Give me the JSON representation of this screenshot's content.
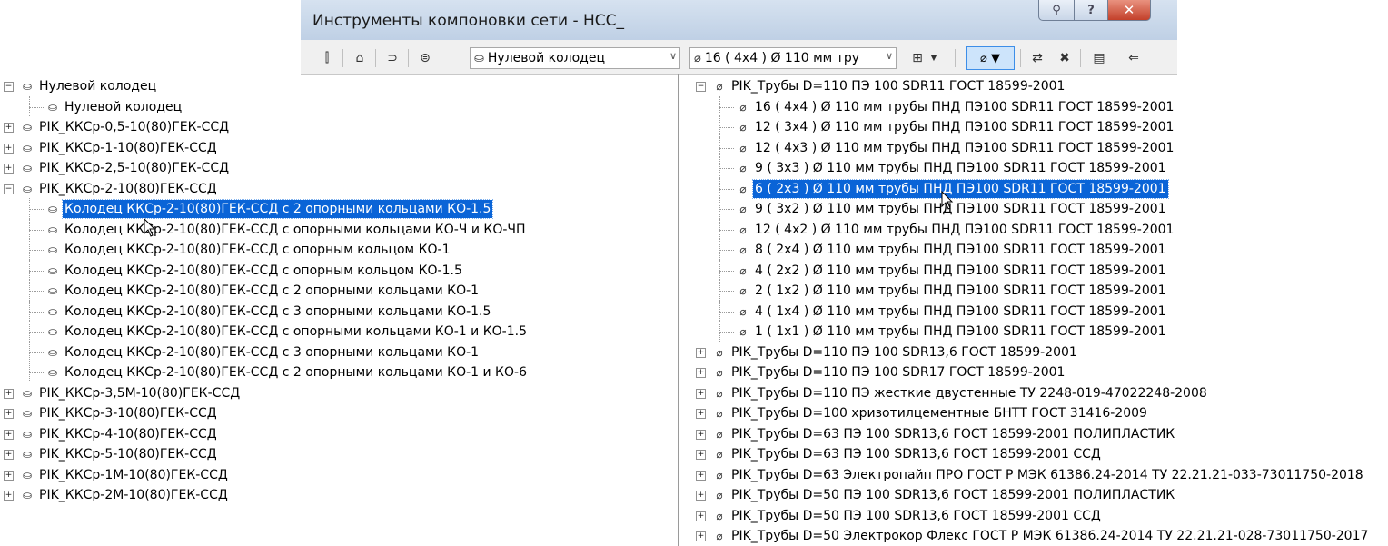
{
  "window": {
    "title": "Инструменты компоновки сети - НСС_",
    "pin_icon": "pin-icon",
    "help_label": "?",
    "close_label": "✕"
  },
  "toolbar": {
    "structure_combo": {
      "value": "Нулевой колодец",
      "icon": "manhole-icon"
    },
    "pipe_combo": {
      "value": "16 ( 4x4 ) Ø 110 мм тру",
      "icon": "pipe-icon"
    },
    "icons": [
      "network-properties-icon",
      "add-structure-icon",
      "draw-pipes-icon",
      "pipe-rules-icon",
      "insert-fitting-icon",
      "draw-pipes-and-structures-icon",
      "swap-part-icon",
      "delete-part-icon",
      "panorama-icon",
      "undo-icon"
    ]
  },
  "left_tree": {
    "items": [
      {
        "label": "Нулевой колодец",
        "level": 0,
        "expander": "−"
      },
      {
        "label": "Нулевой колодец",
        "level": 1
      },
      {
        "label": "PIK_ККСр-0,5-10(80)ГЕК-ССД",
        "level": 0,
        "expander": "+"
      },
      {
        "label": "PIK_ККСр-1-10(80)ГЕК-ССД",
        "level": 0,
        "expander": "+"
      },
      {
        "label": "PIK_ККСр-2,5-10(80)ГЕК-ССД",
        "level": 0,
        "expander": "+"
      },
      {
        "label": "PIK_ККСр-2-10(80)ГЕК-ССД",
        "level": 0,
        "expander": "−"
      },
      {
        "label": "Колодец ККСр-2-10(80)ГЕК-ССД с 2 опорными кольцами КО-1.5",
        "level": 1,
        "selected": true
      },
      {
        "label": "Колодец ККСр-2-10(80)ГЕК-ССД с опорными кольцами КО-Ч и КО-ЧП",
        "level": 1
      },
      {
        "label": "Колодец ККСр-2-10(80)ГЕК-ССД с опорным кольцом КО-1",
        "level": 1
      },
      {
        "label": "Колодец ККСр-2-10(80)ГЕК-ССД с опорным кольцом КО-1.5",
        "level": 1
      },
      {
        "label": "Колодец ККСр-2-10(80)ГЕК-ССД с 2 опорными кольцами КО-1",
        "level": 1
      },
      {
        "label": "Колодец ККСр-2-10(80)ГЕК-ССД с 3 опорными кольцами КО-1.5",
        "level": 1
      },
      {
        "label": "Колодец ККСр-2-10(80)ГЕК-ССД с опорными кольцами КО-1 и КО-1.5",
        "level": 1
      },
      {
        "label": "Колодец ККСр-2-10(80)ГЕК-ССД с 3 опорными кольцами КО-1",
        "level": 1
      },
      {
        "label": "Колодец ККСр-2-10(80)ГЕК-ССД с 2 опорными кольцами КО-1 и КО-6",
        "level": 1
      },
      {
        "label": "PIK_ККСр-3,5М-10(80)ГЕК-ССД",
        "level": 0,
        "expander": "+"
      },
      {
        "label": "PIK_ККСр-3-10(80)ГЕК-ССД",
        "level": 0,
        "expander": "+"
      },
      {
        "label": "PIK_ККСр-4-10(80)ГЕК-ССД",
        "level": 0,
        "expander": "+"
      },
      {
        "label": "PIK_ККСр-5-10(80)ГЕК-ССД",
        "level": 0,
        "expander": "+"
      },
      {
        "label": "PIK_ККСр-1М-10(80)ГЕК-ССД",
        "level": 0,
        "expander": "+"
      },
      {
        "label": "PIK_ККСр-2М-10(80)ГЕК-ССД",
        "level": 0,
        "expander": "+"
      }
    ]
  },
  "right_tree": {
    "items": [
      {
        "label": "PIK_Трубы D=110 ПЭ 100 SDR11 ГОСТ 18599-2001",
        "level": 0,
        "expander": "−"
      },
      {
        "label": "16 ( 4x4 ) Ø 110 мм трубы ПНД ПЭ100 SDR11 ГОСТ 18599-2001",
        "level": 1
      },
      {
        "label": "12 ( 3x4 ) Ø 110 мм трубы ПНД ПЭ100 SDR11 ГОСТ 18599-2001",
        "level": 1
      },
      {
        "label": "12 ( 4x3 ) Ø 110 мм трубы ПНД ПЭ100 SDR11 ГОСТ 18599-2001",
        "level": 1
      },
      {
        "label": "9 ( 3x3 ) Ø 110 мм трубы ПНД ПЭ100 SDR11 ГОСТ 18599-2001",
        "level": 1
      },
      {
        "label": "6 ( 2x3 ) Ø 110 мм трубы ПНД ПЭ100 SDR11 ГОСТ 18599-2001",
        "level": 1,
        "selected": true
      },
      {
        "label": "9 ( 3x2 ) Ø 110 мм трубы ПНД ПЭ100 SDR11 ГОСТ 18599-2001",
        "level": 1
      },
      {
        "label": "12 ( 4x2 ) Ø 110 мм трубы ПНД ПЭ100 SDR11 ГОСТ 18599-2001",
        "level": 1
      },
      {
        "label": "8 ( 2x4 ) Ø 110 мм трубы ПНД ПЭ100 SDR11 ГОСТ 18599-2001",
        "level": 1
      },
      {
        "label": "4 ( 2x2 ) Ø 110 мм трубы ПНД ПЭ100 SDR11 ГОСТ 18599-2001",
        "level": 1
      },
      {
        "label": "2 ( 1x2 ) Ø 110 мм трубы ПНД ПЭ100 SDR11 ГОСТ 18599-2001",
        "level": 1
      },
      {
        "label": "4 ( 1x4 ) Ø 110 мм трубы ПНД ПЭ100 SDR11 ГОСТ 18599-2001",
        "level": 1
      },
      {
        "label": "1 ( 1x1 ) Ø 110 мм трубы ПНД ПЭ100 SDR11 ГОСТ 18599-2001",
        "level": 1
      },
      {
        "label": "PIK_Трубы D=110 ПЭ 100 SDR13,6 ГОСТ 18599-2001",
        "level": 0,
        "expander": "+"
      },
      {
        "label": "PIK_Трубы D=110 ПЭ 100 SDR17 ГОСТ 18599-2001",
        "level": 0,
        "expander": "+"
      },
      {
        "label": "PIK_Трубы D=110 ПЭ жесткие двустенные ТУ 2248-019-47022248-2008",
        "level": 0,
        "expander": "+"
      },
      {
        "label": "PIK_Трубы D=100 хризотилцементные БНТТ ГОСТ 31416-2009",
        "level": 0,
        "expander": "+"
      },
      {
        "label": "PIK_Трубы D=63 ПЭ 100 SDR13,6 ГОСТ 18599-2001 ПОЛИПЛАСТИК",
        "level": 0,
        "expander": "+"
      },
      {
        "label": "PIK_Трубы D=63 ПЭ 100 SDR13,6 ГОСТ 18599-2001 ССД",
        "level": 0,
        "expander": "+"
      },
      {
        "label": "PIK_Трубы D=63 Электропайп ПРО ГОСТ Р МЭК 61386.24-2014 ТУ 22.21.21-033-73011750-2018",
        "level": 0,
        "expander": "+"
      },
      {
        "label": "PIK_Трубы D=50 ПЭ 100 SDR13,6 ГОСТ 18599-2001 ПОЛИПЛАСТИК",
        "level": 0,
        "expander": "+"
      },
      {
        "label": "PIK_Трубы D=50 ПЭ 100 SDR13,6 ГОСТ 18599-2001 ССД",
        "level": 0,
        "expander": "+"
      },
      {
        "label": "PIK_Трубы D=50 Электрокор Флекс ГОСТ Р МЭК 61386.24-2014 ТУ 22.21.21-028-73011750-2017",
        "level": 0,
        "expander": "+"
      }
    ]
  },
  "colors": {
    "selection": "#0a64d7",
    "titlebar": "#c8d8ec",
    "close": "#c3402a"
  }
}
